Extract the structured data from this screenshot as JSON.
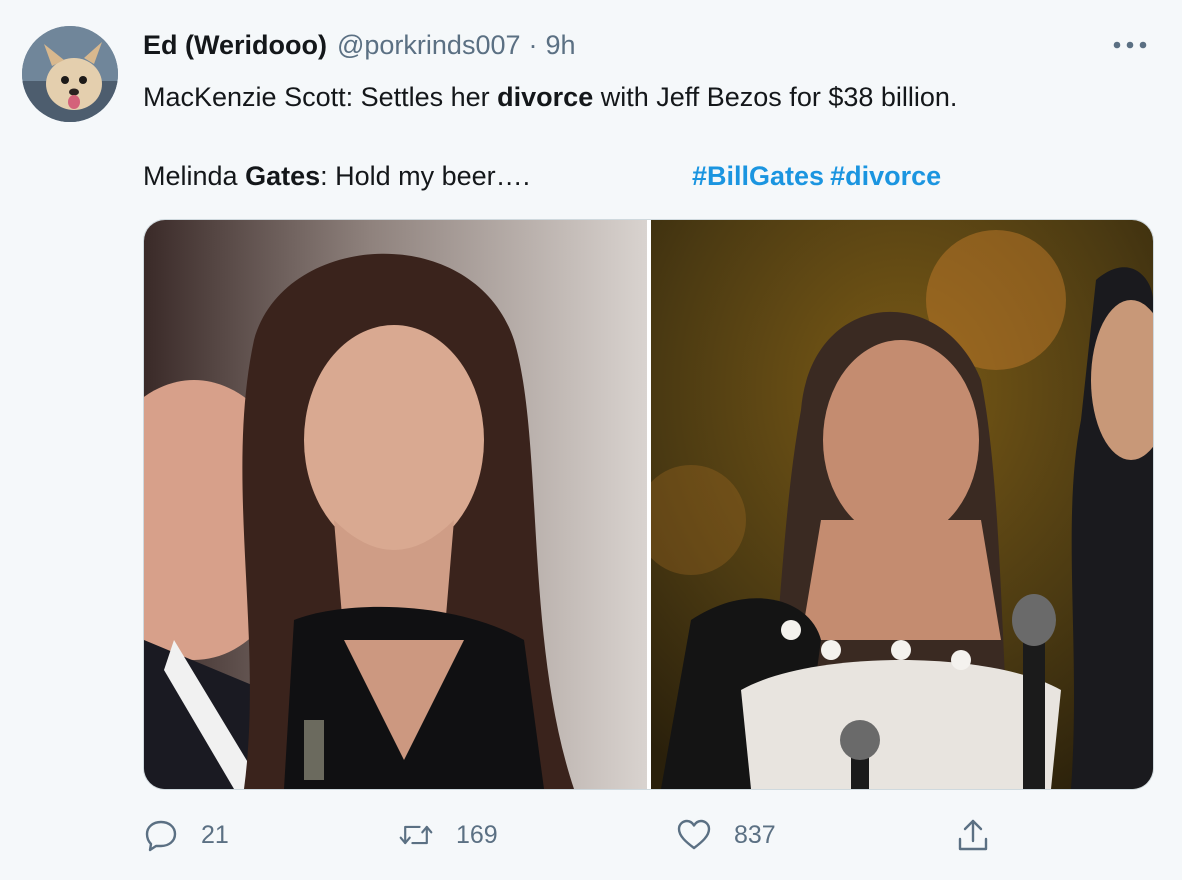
{
  "tweet": {
    "display_name": "Ed (Weridooo)",
    "handle": "@porkrinds007",
    "separator": "·",
    "time": "9h",
    "line1": {
      "pre": "MacKenzie Scott: Settles her ",
      "bold": "divorce",
      "post": " with Jeff Bezos for $38 billion."
    },
    "line2": {
      "pre": "Melinda ",
      "bold": "Gates",
      "post": ": Hold my beer…."
    },
    "hashtags": [
      "#BillGates",
      "#divorce"
    ]
  },
  "actions": {
    "reply_icon": "reply-bubble-icon",
    "reply_count": "21",
    "retweet_icon": "retweet-icon",
    "retweet_count": "169",
    "like_icon": "heart-icon",
    "like_count": "837",
    "share_icon": "share-upload-icon"
  },
  "colors": {
    "background": "#f5f8fa",
    "text": "#14171a",
    "secondary": "#5b7083",
    "link": "#1b95e0"
  }
}
